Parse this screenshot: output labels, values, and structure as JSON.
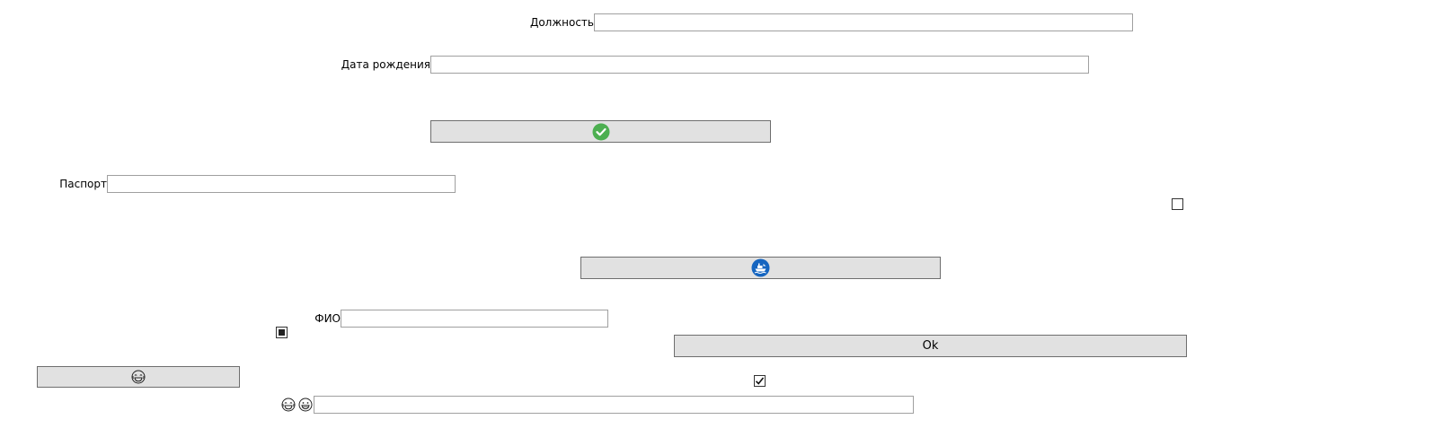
{
  "form": {
    "position_label": "Должность",
    "position_value": "",
    "birthdate_label": "Дата рождения",
    "birthdate_value": "",
    "passport_label": "Паспорт",
    "passport_value": "",
    "fio_label": "ФИО",
    "fio_value": "",
    "bottom_field_value": ""
  },
  "buttons": {
    "ok_label": "Ok",
    "confirm_icon": "check-circle-icon",
    "ship_icon": "ship-circle-icon",
    "emoji_icon": "laughing-face-icon"
  },
  "checkboxes": {
    "checkbox_right_checked": false,
    "checkbox_indeterminate": true,
    "checkbox_checked": true
  },
  "icons": {
    "bottom_left_icon_1": "laughing-face-icon",
    "bottom_left_icon_2": "grinning-face-icon"
  },
  "colors": {
    "check_green": "#4CAF50",
    "ship_blue": "#1565C0",
    "button_bg": "#E1E1E1",
    "field_border": "#A0A0A0"
  }
}
